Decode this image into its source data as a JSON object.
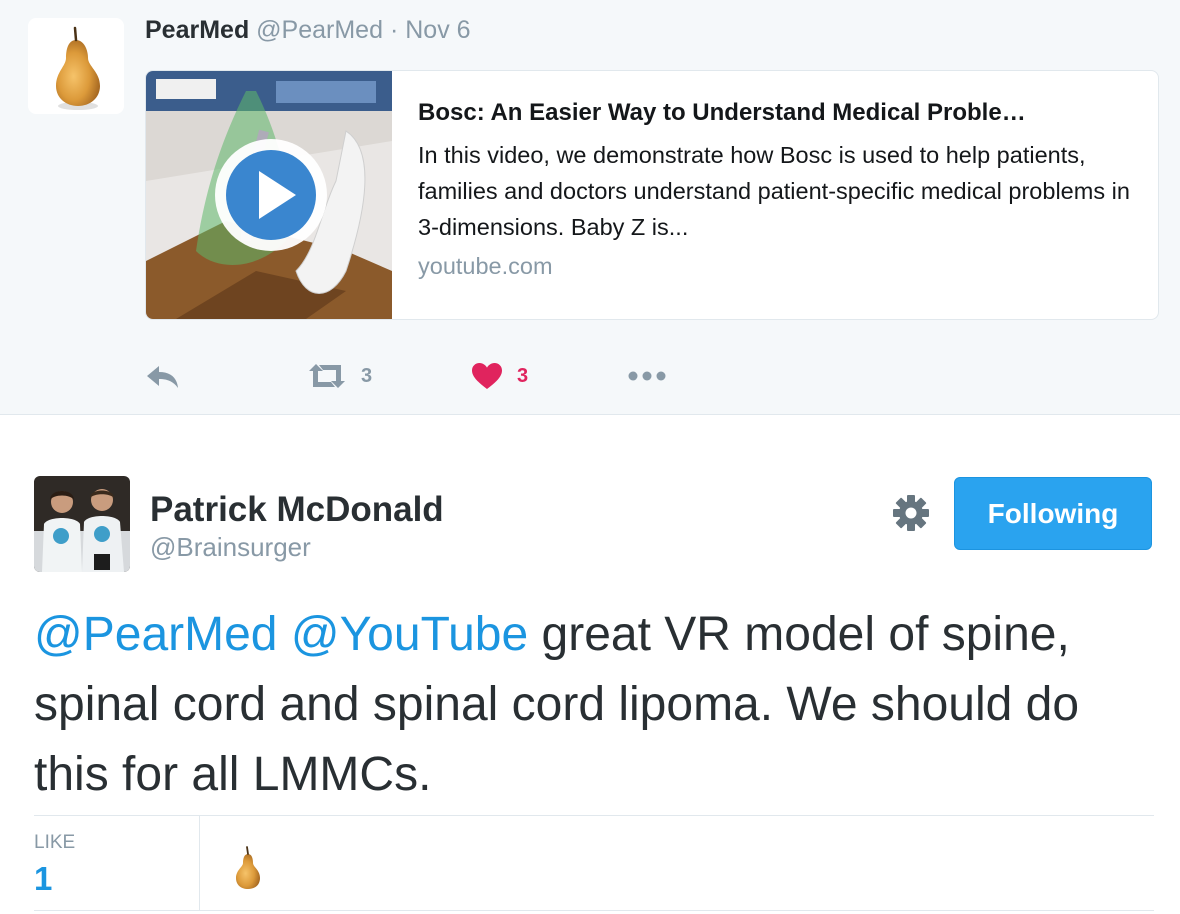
{
  "quoted_tweet": {
    "name": "PearMed",
    "handle": "@PearMed",
    "separator": "·",
    "date": "Nov 6",
    "card": {
      "title": "Bosc: An Easier Way to Understand Medical Proble…",
      "description": "In this video, we demonstrate how Bosc is used to help patients, families and doctors understand patient-specific medical problems in 3-dimensions. Baby Z is...",
      "domain": "youtube.com"
    },
    "actions": {
      "retweet_count": "3",
      "like_count": "3"
    }
  },
  "tweet": {
    "author_name": "Patrick McDonald",
    "author_handle": "@Brainsurger",
    "follow_label": "Following",
    "mention1": "@PearMed",
    "mention2": "@YouTube",
    "body": " great VR model of spine, spinal cord and spinal cord lipoma. We should do this for all LMMCs.",
    "like_label": "LIKE",
    "like_count": "1"
  },
  "icons": {
    "reply": "reply-icon",
    "retweet": "retweet-icon",
    "like": "heart-icon",
    "more": "more-icon",
    "settings": "gear-icon",
    "play": "play-icon"
  },
  "colors": {
    "link": "#1b95e0",
    "like": "#e0245e",
    "follow_button": "#2aa3ef",
    "muted": "#8899a6"
  }
}
